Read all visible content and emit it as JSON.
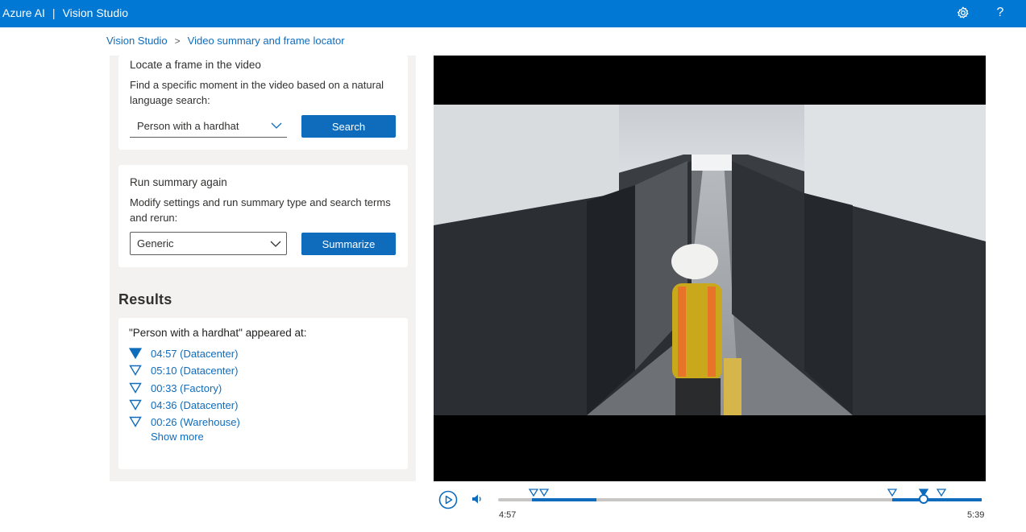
{
  "app": {
    "brand": "Azure AI",
    "product": "Vision Studio",
    "separator": "|",
    "settings_icon": "gear-icon",
    "help_icon": "help-icon",
    "help_glyph": "?"
  },
  "breadcrumb": {
    "root": "Vision Studio",
    "current": "Video summary and frame locator"
  },
  "locate": {
    "title": "Locate a frame in the video",
    "description": "Find a specific moment in the video based on a natural language search:",
    "query": "Person with a hardhat",
    "search_label": "Search"
  },
  "summary": {
    "title": "Run summary again",
    "description": "Modify settings and run summary type and search terms and rerun:",
    "type_selected": "Generic",
    "summarize_label": "Summarize"
  },
  "results": {
    "heading": "Results",
    "intro": "\"Person with a hardhat\" appeared at:",
    "items": [
      {
        "label": "04:57 (Datacenter)",
        "active": true
      },
      {
        "label": "05:10 (Datacenter)",
        "active": false
      },
      {
        "label": "00:33 (Factory)",
        "active": false
      },
      {
        "label": "04:36 (Datacenter)",
        "active": false
      },
      {
        "label": "00:26 (Warehouse)",
        "active": false
      }
    ],
    "show_more": "Show more"
  },
  "player": {
    "current_time": "4:57",
    "duration": "5:39",
    "progress_fraction": 0.88
  },
  "colors": {
    "accent": "#0f6cbd",
    "topbar": "#0078d4",
    "panel": "#f3f2f1"
  }
}
